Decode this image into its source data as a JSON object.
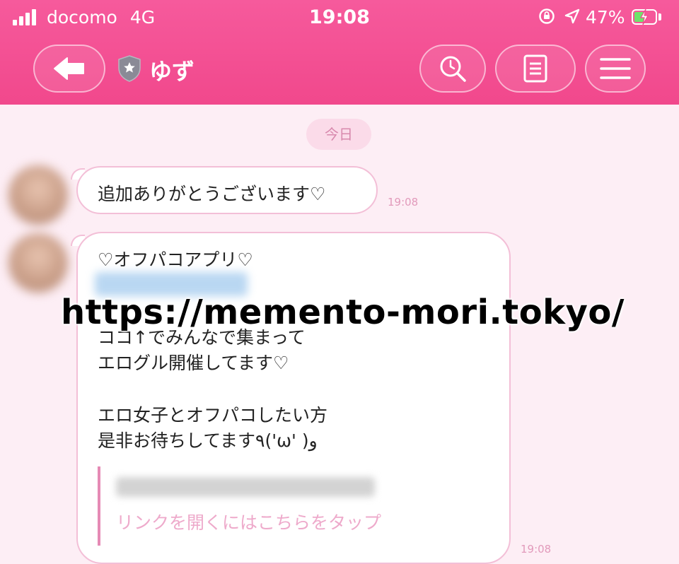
{
  "status_bar": {
    "carrier": "docomo",
    "network": "4G",
    "time": "19:08",
    "battery_percent": "47%",
    "battery_level": 0.47
  },
  "header": {
    "title": "ゆず",
    "icons": [
      "back-arrow-icon",
      "shield-star-icon",
      "search-icon",
      "notes-icon",
      "menu-icon"
    ]
  },
  "chat": {
    "date_label": "今日",
    "messages": [
      {
        "text": "追加ありがとうございます♡",
        "time": "19:08"
      },
      {
        "lines": [
          "♡オフパコアプリ♡",
          "ココ↑でみんなで集まって",
          "エログル開催してます♡",
          "エロ女子とオフパコしたい方",
          "是非お待ちしてます٩('ω' )و"
        ],
        "link_prompt": "リンクを開くにはこちらをタップ",
        "time": "19:08"
      }
    ]
  },
  "watermark": "https://memento-mori.tokyo/",
  "colors": {
    "header_pink": "#f1488c",
    "background": "#fdeef5",
    "bubble_border": "#f3bfd7",
    "time_text": "#e29abb"
  }
}
